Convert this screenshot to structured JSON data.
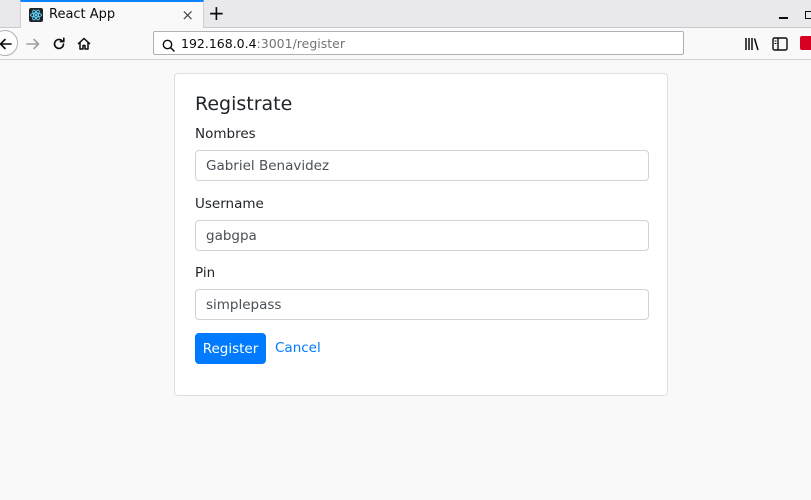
{
  "browser": {
    "tab_title": "React App",
    "tab_close": "×",
    "new_tab": "+",
    "url_host": "192.168.0.4",
    "url_rest": ":3001/register",
    "icons": {
      "favicon": "react-icon",
      "back": "arrow-left-icon",
      "forward": "arrow-right-icon",
      "reload": "reload-icon",
      "home": "home-icon",
      "search": "search-icon",
      "library": "library-icon",
      "sidebar": "sidebar-icon",
      "extension": "extension-icon"
    }
  },
  "form": {
    "title": "Registrate",
    "fields": [
      {
        "label": "Nombres",
        "value": "Gabriel Benavidez"
      },
      {
        "label": "Username",
        "value": "gabgpa"
      },
      {
        "label": "Pin",
        "value": "simplepass"
      }
    ],
    "submit_label": "Register",
    "cancel_label": "Cancel"
  },
  "colors": {
    "primary": "#007bff",
    "page_bg": "#f9f9fa",
    "tab_accent": "#0a84ff"
  }
}
